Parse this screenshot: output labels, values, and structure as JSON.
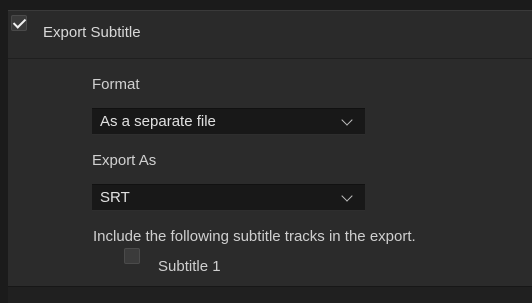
{
  "export_subtitle": {
    "checked": true,
    "title": "Export Subtitle"
  },
  "format": {
    "label": "Format",
    "selected": "As a separate file"
  },
  "export_as": {
    "label": "Export As",
    "selected": "SRT"
  },
  "tracks": {
    "instruction": "Include the following subtitle tracks in the export.",
    "items": [
      {
        "label": "Subtitle 1",
        "checked": false
      }
    ]
  }
}
